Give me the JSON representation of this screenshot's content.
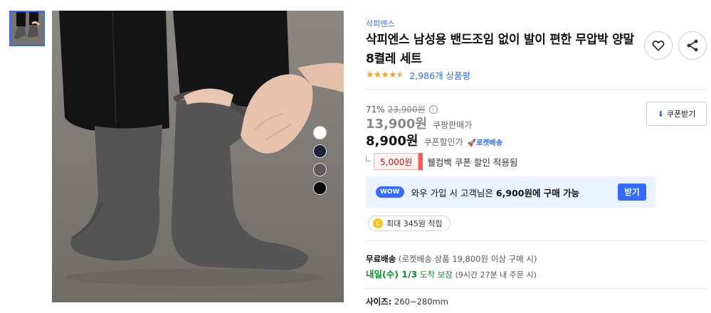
{
  "gallery": {
    "thumbnail_alt": "product-thumbnail",
    "swatch_colors": [
      "#ffffff",
      "#1e2336",
      "#5a5a5a",
      "#050505"
    ]
  },
  "product": {
    "brand": "삭피엔스",
    "title": "삭피엔스 남성용 밴드조임 없이 발이 편한 무압박 양말 8켤레 세트",
    "rating": 4.5,
    "review_count": "2,986개 상품평"
  },
  "price": {
    "discount_rate": "71%",
    "original_price": "23,900원",
    "coupang_price": "13,900원",
    "coupang_price_label": "쿠팡판매가",
    "coupon_price": "8,900원",
    "coupon_price_label": "쿠폰할인가",
    "rocket_label": "로켓배송",
    "coupon_button_label": "쿠폰받기"
  },
  "welcome": {
    "amount": "5,000원",
    "text": "웰컴백 쿠폰 할인 적용됨"
  },
  "wow": {
    "badge": "WOW",
    "text_before": "와우 가입 시 고객님은 ",
    "highlight": "6,900원에 구매 가능",
    "button_label": "받기"
  },
  "reward": {
    "coin_letter": "C",
    "text": "최대 345원 적립"
  },
  "shipping": {
    "free_label": "무료배송",
    "free_detail": "(로켓배송 상품 19,800원 이상 구매 시)",
    "arrival": "내일(수) 1/3",
    "arrival_suffix": "도착 보장",
    "arrival_detail": "(9시간 27분 내 주문 시)"
  },
  "size": {
    "label": "사이즈:",
    "value": "260~280mm"
  },
  "colors": {
    "accent": "#346aff",
    "green": "#0a8f2e",
    "red": "#c2180b",
    "star": "#f9a416"
  }
}
